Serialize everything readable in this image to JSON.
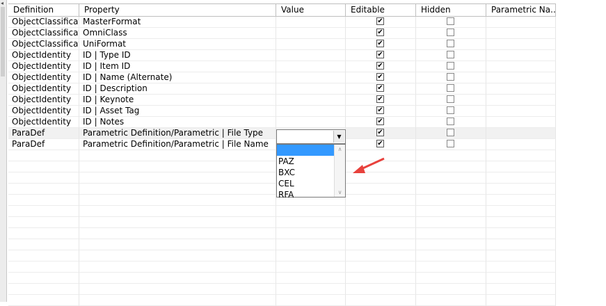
{
  "columns": [
    "Definition",
    "Property",
    "Value",
    "Editable",
    "Hidden",
    "Parametric Na..."
  ],
  "rows": [
    {
      "definition": "ObjectClassificatio",
      "property": "MasterFormat",
      "value": "",
      "editable": true,
      "hidden": false
    },
    {
      "definition": "ObjectClassificatio",
      "property": "OmniClass",
      "value": "",
      "editable": true,
      "hidden": false
    },
    {
      "definition": "ObjectClassificatio",
      "property": "UniFormat",
      "value": "",
      "editable": true,
      "hidden": false
    },
    {
      "definition": "ObjectIdentity",
      "property": "ID | Type ID",
      "value": "",
      "editable": true,
      "hidden": false
    },
    {
      "definition": "ObjectIdentity",
      "property": "ID | Item ID",
      "value": "",
      "editable": true,
      "hidden": false
    },
    {
      "definition": "ObjectIdentity",
      "property": "ID | Name (Alternate)",
      "value": "",
      "editable": true,
      "hidden": false
    },
    {
      "definition": "ObjectIdentity",
      "property": "ID | Description",
      "value": "",
      "editable": true,
      "hidden": false
    },
    {
      "definition": "ObjectIdentity",
      "property": "ID | Keynote",
      "value": "",
      "editable": true,
      "hidden": false
    },
    {
      "definition": "ObjectIdentity",
      "property": "ID | Asset Tag",
      "value": "",
      "editable": true,
      "hidden": false
    },
    {
      "definition": "ObjectIdentity",
      "property": "ID | Notes",
      "value": "",
      "editable": true,
      "hidden": false
    },
    {
      "definition": "ParaDef",
      "property": "Parametric Definition/Parametric | File Type",
      "value": "",
      "editable": true,
      "hidden": false
    },
    {
      "definition": "ParaDef",
      "property": "Parametric Definition/Parametric | File Name",
      "value": "",
      "editable": true,
      "hidden": false
    }
  ],
  "dropdown": {
    "selected": "",
    "options": [
      "",
      "PAZ",
      "BXC",
      "CEL",
      "RFA"
    ]
  },
  "empty_rows": 14,
  "annotation_color": "#e8413c",
  "selection_color": "#3399ff"
}
